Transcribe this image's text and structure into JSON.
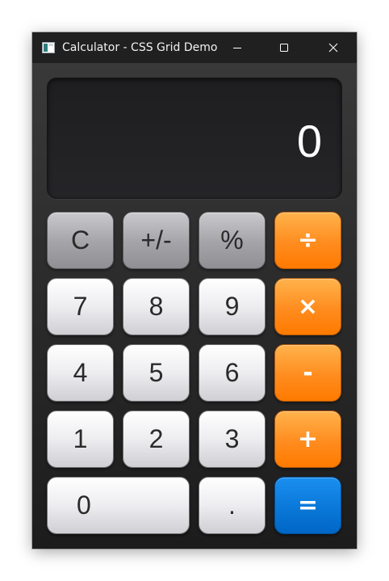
{
  "window": {
    "title": "Calculator - CSS Grid Demo",
    "icon": "calculator-app-icon",
    "controls": {
      "minimize_icon": "minimize-icon",
      "maximize_icon": "maximize-icon",
      "close_icon": "close-icon"
    }
  },
  "display": {
    "value": "0"
  },
  "keypad": {
    "clear": "C",
    "sign": "+/-",
    "percent": "%",
    "divide": "÷",
    "seven": "7",
    "eight": "8",
    "nine": "9",
    "multiply": "×",
    "four": "4",
    "five": "5",
    "six": "6",
    "subtract": "-",
    "one": "1",
    "two": "2",
    "three": "3",
    "add": "+",
    "zero": "0",
    "decimal": ".",
    "equals": "="
  },
  "colors": {
    "operator": "#ff8c1f",
    "equals": "#0a78d8",
    "function_key": "#a3a3a8",
    "digit_key": "#ededf0",
    "display_bg": "#1e1e20"
  }
}
